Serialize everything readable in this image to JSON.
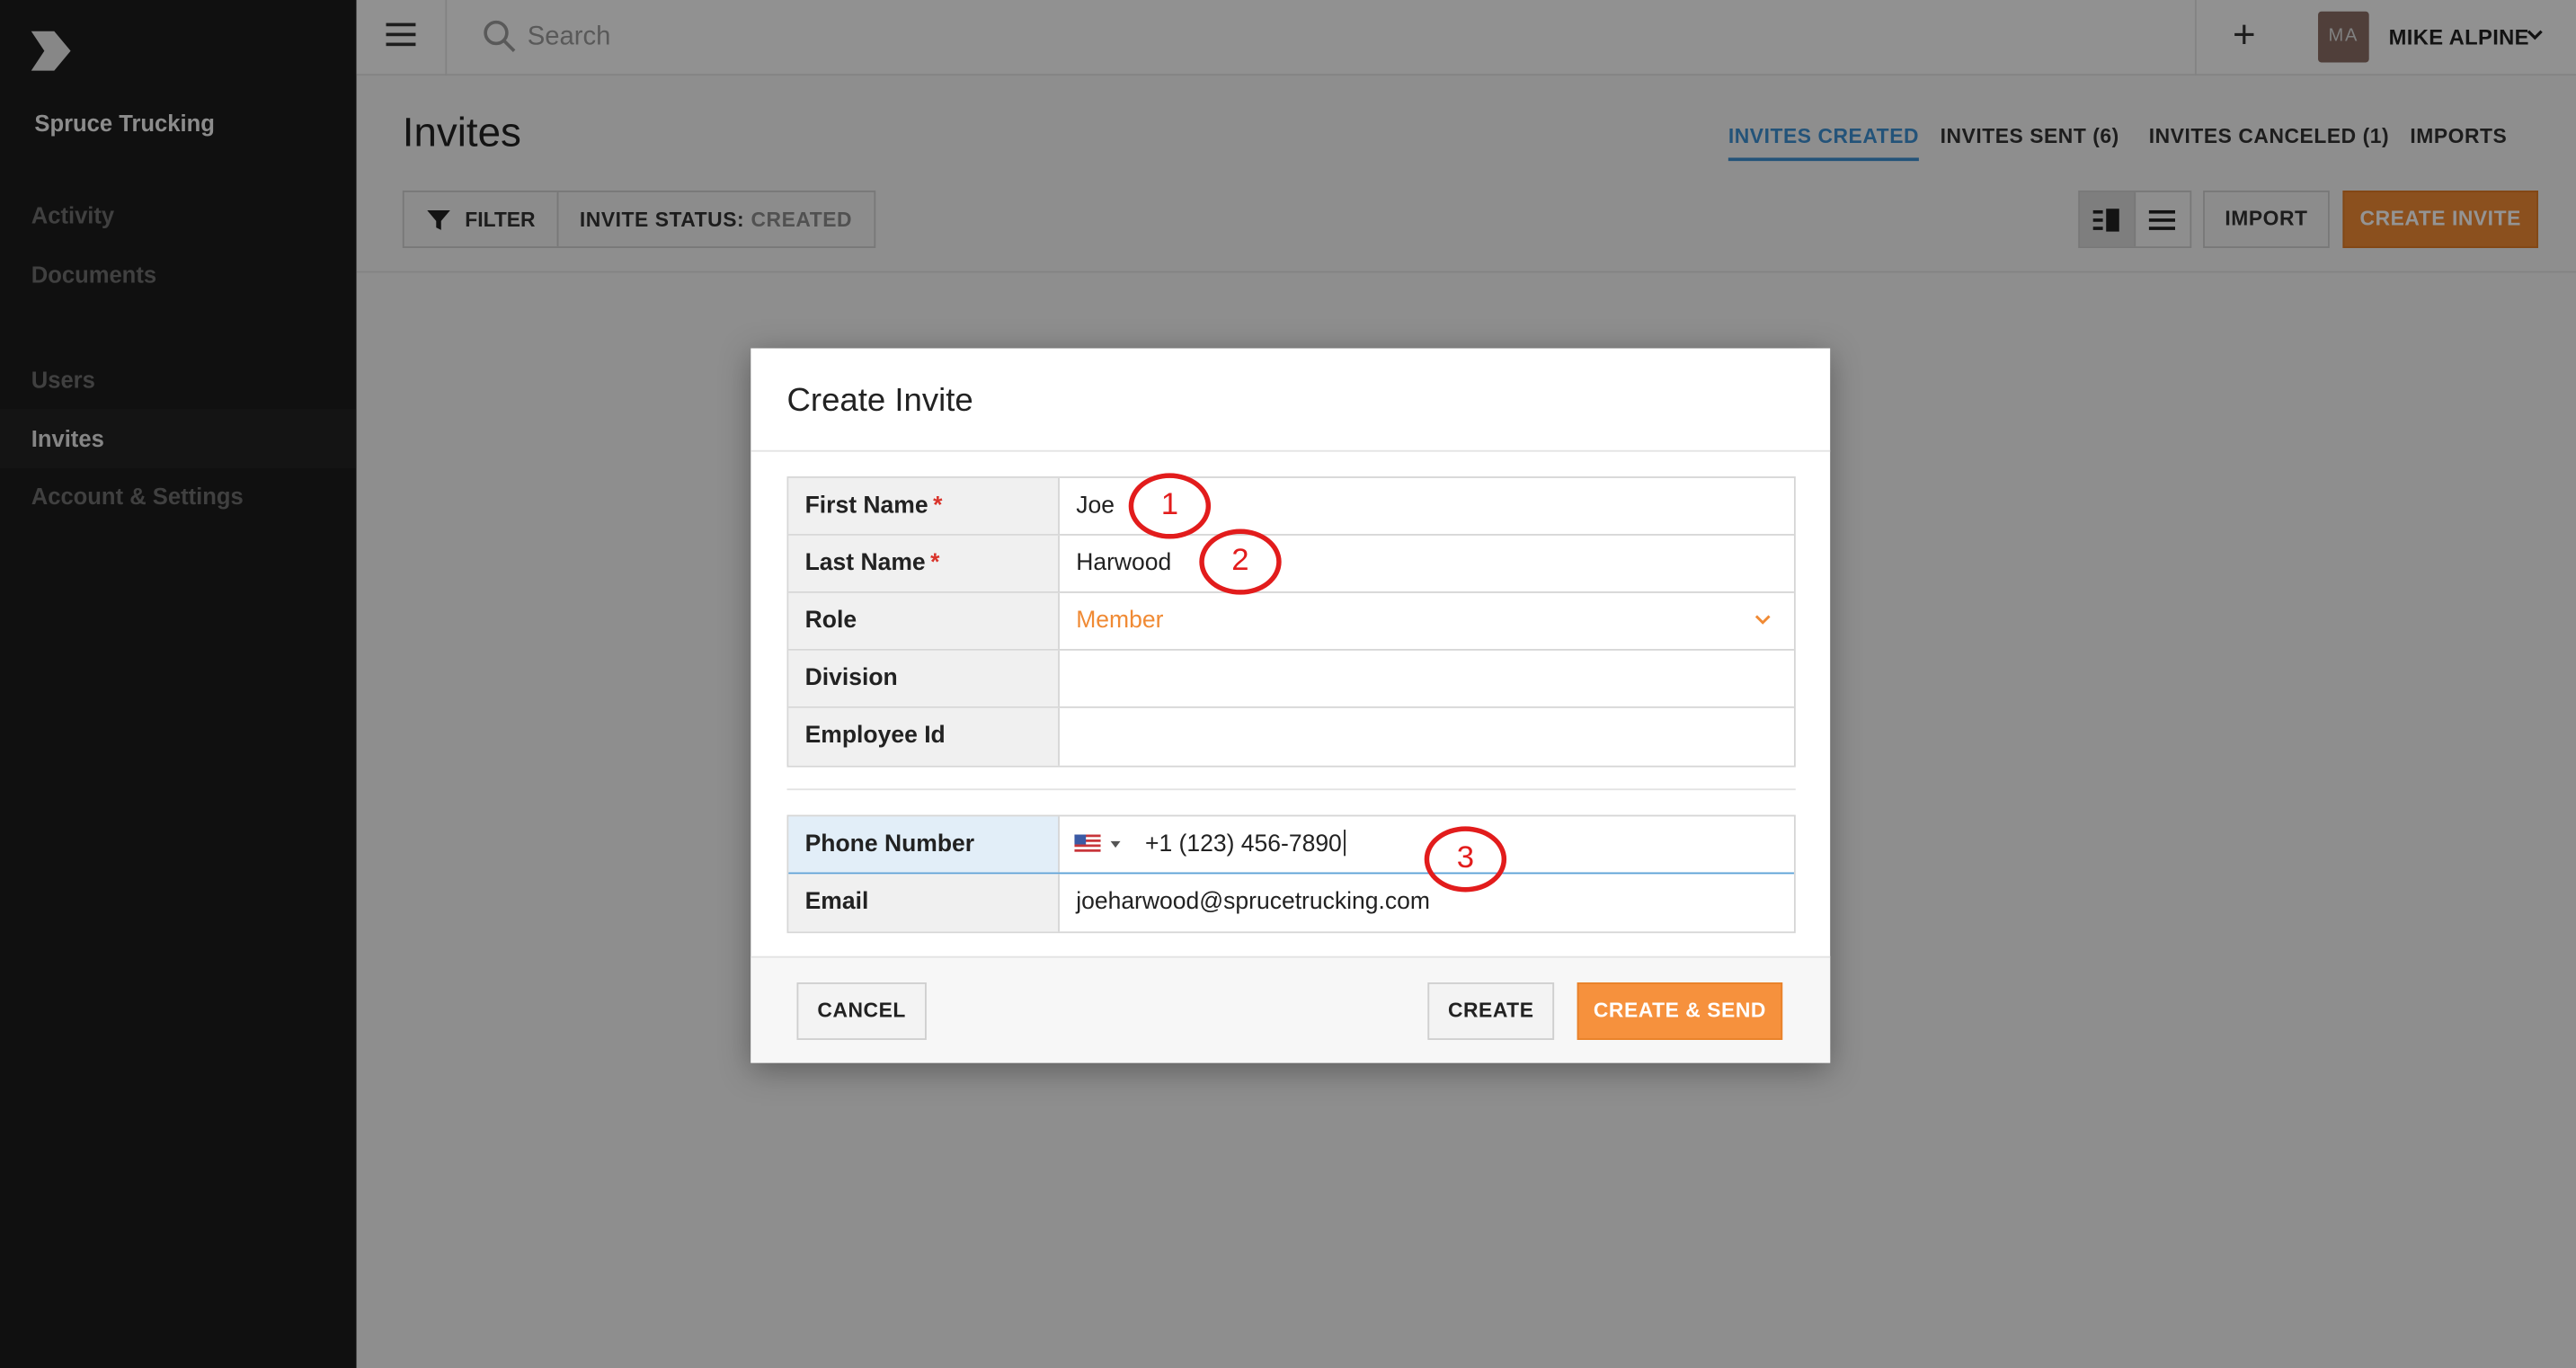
{
  "sidebar": {
    "company": "Spruce Trucking",
    "items": [
      {
        "label": "Activity"
      },
      {
        "label": "Documents"
      },
      {
        "label": "Users"
      },
      {
        "label": "Invites"
      },
      {
        "label": "Account & Settings"
      }
    ]
  },
  "topbar": {
    "search_placeholder": "Search",
    "avatar_initials": "MA",
    "user_name": "MIKE ALPINE"
  },
  "page": {
    "title": "Invites",
    "tabs": [
      {
        "label": "INVITES CREATED"
      },
      {
        "label": "INVITES SENT (6)"
      },
      {
        "label": "INVITES CANCELED (1)"
      },
      {
        "label": "IMPORTS"
      }
    ],
    "filter_label": "FILTER",
    "status_key": "INVITE STATUS:",
    "status_value": "CREATED",
    "import_label": "IMPORT",
    "create_invite_label": "CREATE INVITE"
  },
  "modal": {
    "title": "Create Invite",
    "fields": [
      {
        "label": "First Name",
        "required": "*",
        "value": "Joe"
      },
      {
        "label": "Last Name",
        "required": "*",
        "value": "Harwood"
      },
      {
        "label": "Role",
        "value": "Member"
      },
      {
        "label": "Division",
        "value": ""
      },
      {
        "label": "Employee Id",
        "value": ""
      }
    ],
    "contact": [
      {
        "label": "Phone Number",
        "value": "+1 (123) 456-7890"
      },
      {
        "label": "Email",
        "value": "joeharwood@sprucetrucking.com"
      }
    ],
    "cancel_label": "CANCEL",
    "create_label": "CREATE",
    "create_send_label": "CREATE & SEND"
  },
  "annotations": [
    "1",
    "2",
    "3"
  ],
  "colors": {
    "accent_orange": "#f08a34",
    "tab_active_blue": "#3d8fd1",
    "annotation_red": "#e21c1c"
  }
}
